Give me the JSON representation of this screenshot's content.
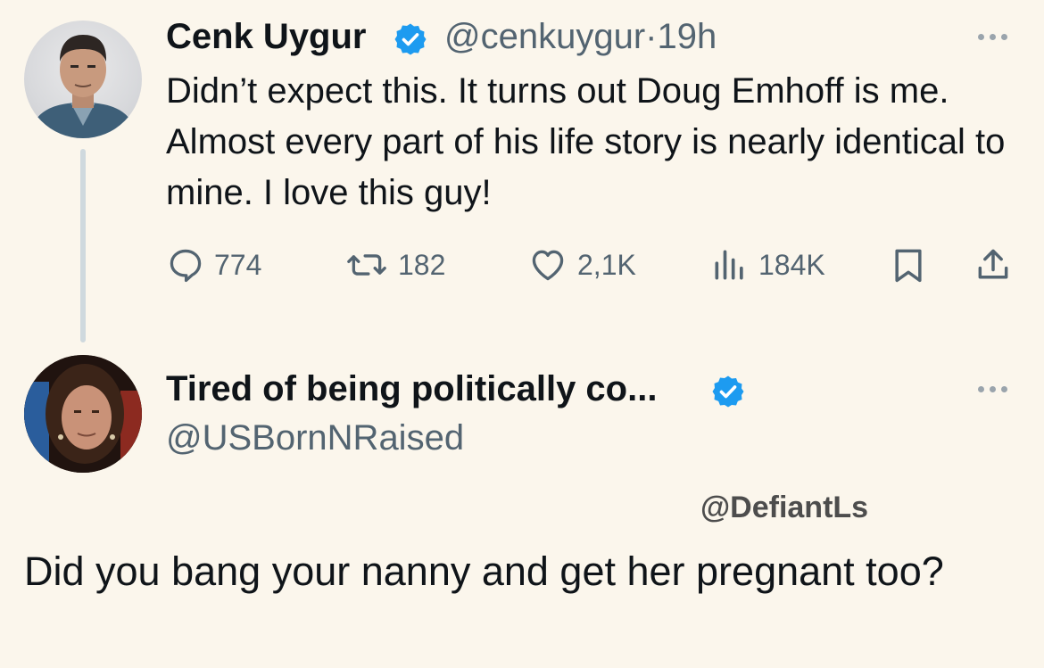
{
  "tweet": {
    "author_name": "Cenk Uygur",
    "handle": "@cenkuygur",
    "separator": "·",
    "time": "19h",
    "text": "Didn’t expect this. It turns out Doug Emhoff is me. Almost every part of his life story is nearly identical to mine. I love this guy!",
    "replies": "774",
    "reposts": "182",
    "likes": "2,1K",
    "views": "184K",
    "verified_color": "#1d9bf0"
  },
  "reply": {
    "author_name": "Tired of being politically co...",
    "handle": "@USBornNRaised",
    "watermark": "@DefiantLs",
    "text": "Did you bang your nanny and get her pregnant too?"
  },
  "icons": [
    "reply-icon",
    "repost-icon",
    "like-icon",
    "views-icon",
    "bookmark-icon",
    "share-icon",
    "more-icon",
    "verified-icon"
  ]
}
